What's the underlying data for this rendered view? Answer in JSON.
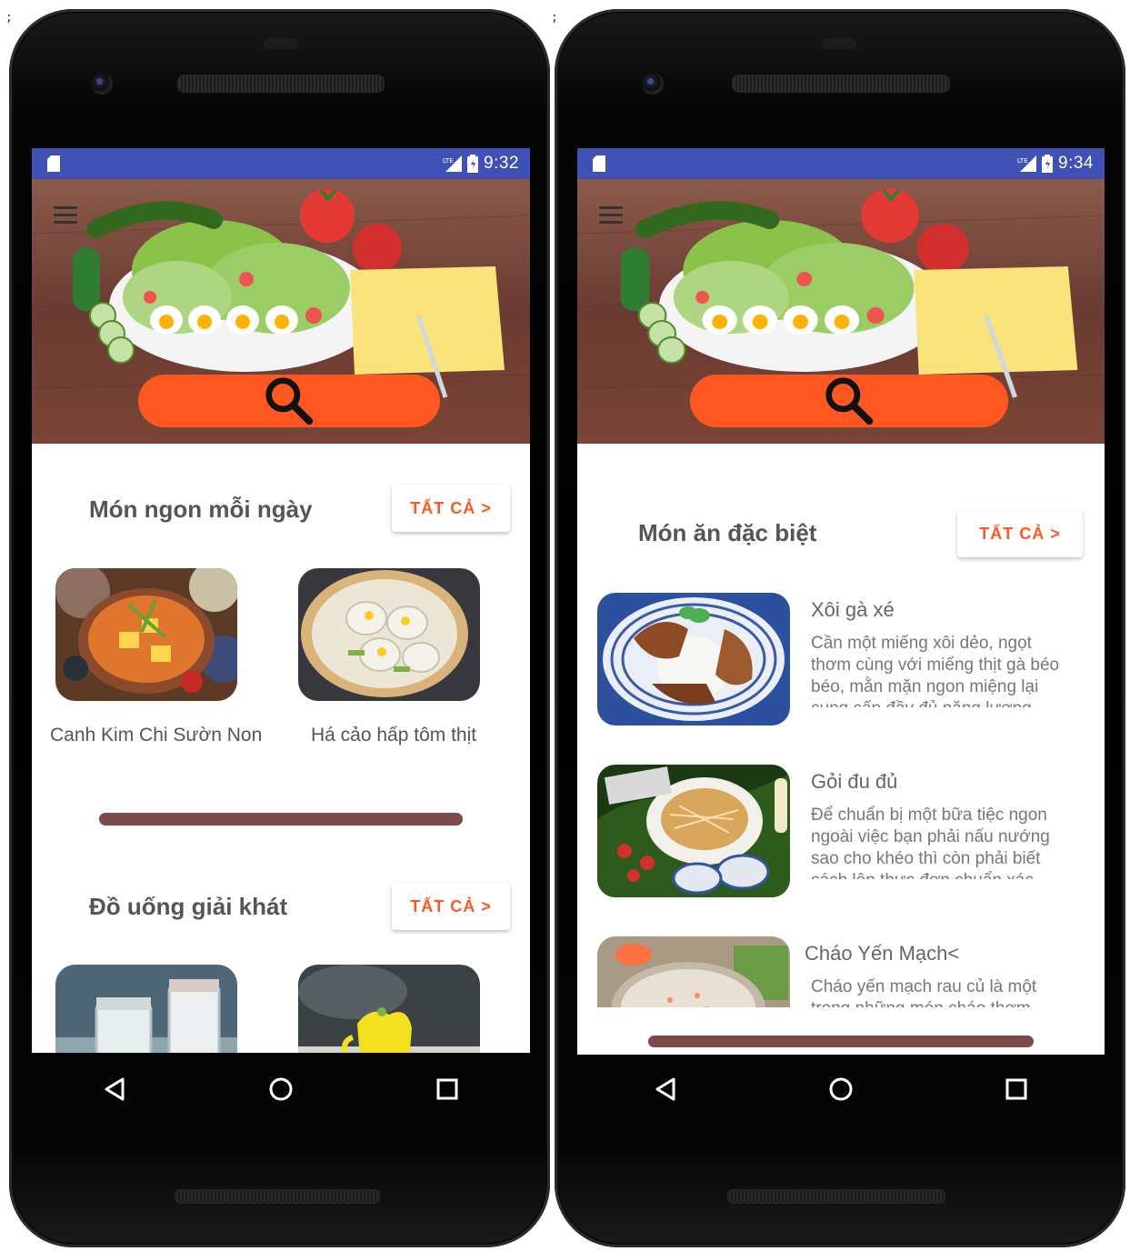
{
  "colors": {
    "status_bar": "#3f51b5",
    "accent": "#ff5722",
    "divider": "#7b4a49",
    "title_text": "#555555"
  },
  "left_phone": {
    "status": {
      "network": "LTE",
      "time": "9:32"
    },
    "sections": [
      {
        "title": "Món ngon mỗi ngày",
        "button": "TẤT CẢ >",
        "items": [
          {
            "name": "Canh Kim Chi Sườn Non",
            "image": "kimchi-soup-image"
          },
          {
            "name": "Há cảo hấp tôm thịt",
            "image": "dumplings-image"
          }
        ]
      },
      {
        "title": "Đồ uống giải khát",
        "button": "TẤT CẢ >",
        "items": [
          {
            "name": "",
            "image": "drink-jars-image"
          },
          {
            "name": "",
            "image": "mango-drink-image"
          }
        ]
      }
    ]
  },
  "right_phone": {
    "status": {
      "network": "LTE",
      "time": "9:34"
    },
    "section": {
      "title": "Món ăn đặc biệt",
      "button": "TẤT CẢ >",
      "items": [
        {
          "title": "Xôi gà xé",
          "desc": "Cần một miếng xôi dẻo, ngọt thơm cùng với miếng thịt gà béo béo, mằn mặn ngon miệng lại cung cấp đầy đủ năng lượng",
          "image": "sticky-rice-chicken-image"
        },
        {
          "title": "Gỏi đu đủ",
          "desc": "Để chuẩn bị một bữa tiệc ngon ngoài việc bạn phải nấu nướng sao cho khéo thì còn phải biết cách lên thực đơn chuẩn xác",
          "image": "papaya-salad-image"
        },
        {
          "title": "Cháo Yến Mạch<",
          "desc": "Cháo yến mạch rau củ là một trong những món cháo thơm",
          "image": "oat-porridge-image"
        }
      ]
    }
  },
  "navigation": {
    "back": "back-icon",
    "home": "home-icon",
    "recents": "recents-icon"
  }
}
